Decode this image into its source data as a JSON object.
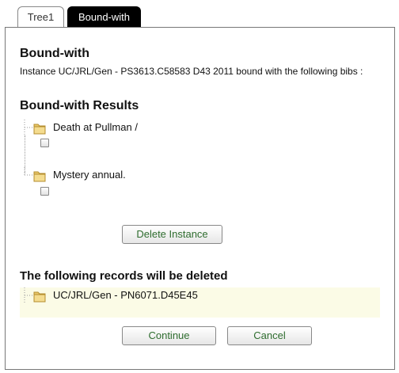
{
  "tabs": [
    {
      "label": "Tree1",
      "active": false
    },
    {
      "label": "Bound-with",
      "active": true
    }
  ],
  "section_title": "Bound-with",
  "description": "Instance UC/JRL/Gen - PS3613.C58583 D43 2011 bound with the following bibs :",
  "results_title": "Bound-with Results",
  "results": [
    {
      "label": "Death at Pullman /",
      "checked": false
    },
    {
      "label": "Mystery annual.",
      "checked": false
    }
  ],
  "delete_instance_label": "Delete Instance",
  "deleted_title": "The following records will be deleted",
  "deleted_records": [
    "UC/JRL/Gen - PN6071.D45E45"
  ],
  "continue_label": "Continue",
  "cancel_label": "Cancel",
  "colors": {
    "button_text": "#2f6d2f",
    "highlight_bg": "#fbfbe6",
    "active_tab_bg": "#000000"
  }
}
